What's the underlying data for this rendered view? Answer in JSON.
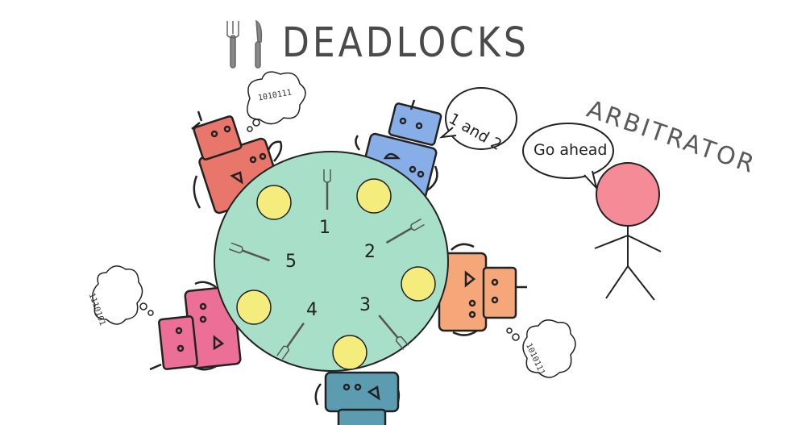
{
  "title": "DEADLOCKS",
  "arbitrator": {
    "label": "ARBITRATOR",
    "speech": "Go ahead"
  },
  "robot_speech": "1 and 2",
  "thought_bubbles": [
    "1010111",
    "1110101",
    "1010111"
  ],
  "seat_numbers": [
    "1",
    "2",
    "3",
    "4",
    "5"
  ],
  "colors": {
    "table": "#a8dfc8",
    "plate": "#f4ec7c",
    "robot_red": "#e8766a",
    "robot_blue": "#87aee6",
    "robot_orange": "#f6a77a",
    "robot_teal": "#5c9cb0",
    "robot_pink": "#ec6f98",
    "arbitrator_head": "#f48b96"
  },
  "icons": [
    "fork-icon",
    "knife-icon"
  ]
}
